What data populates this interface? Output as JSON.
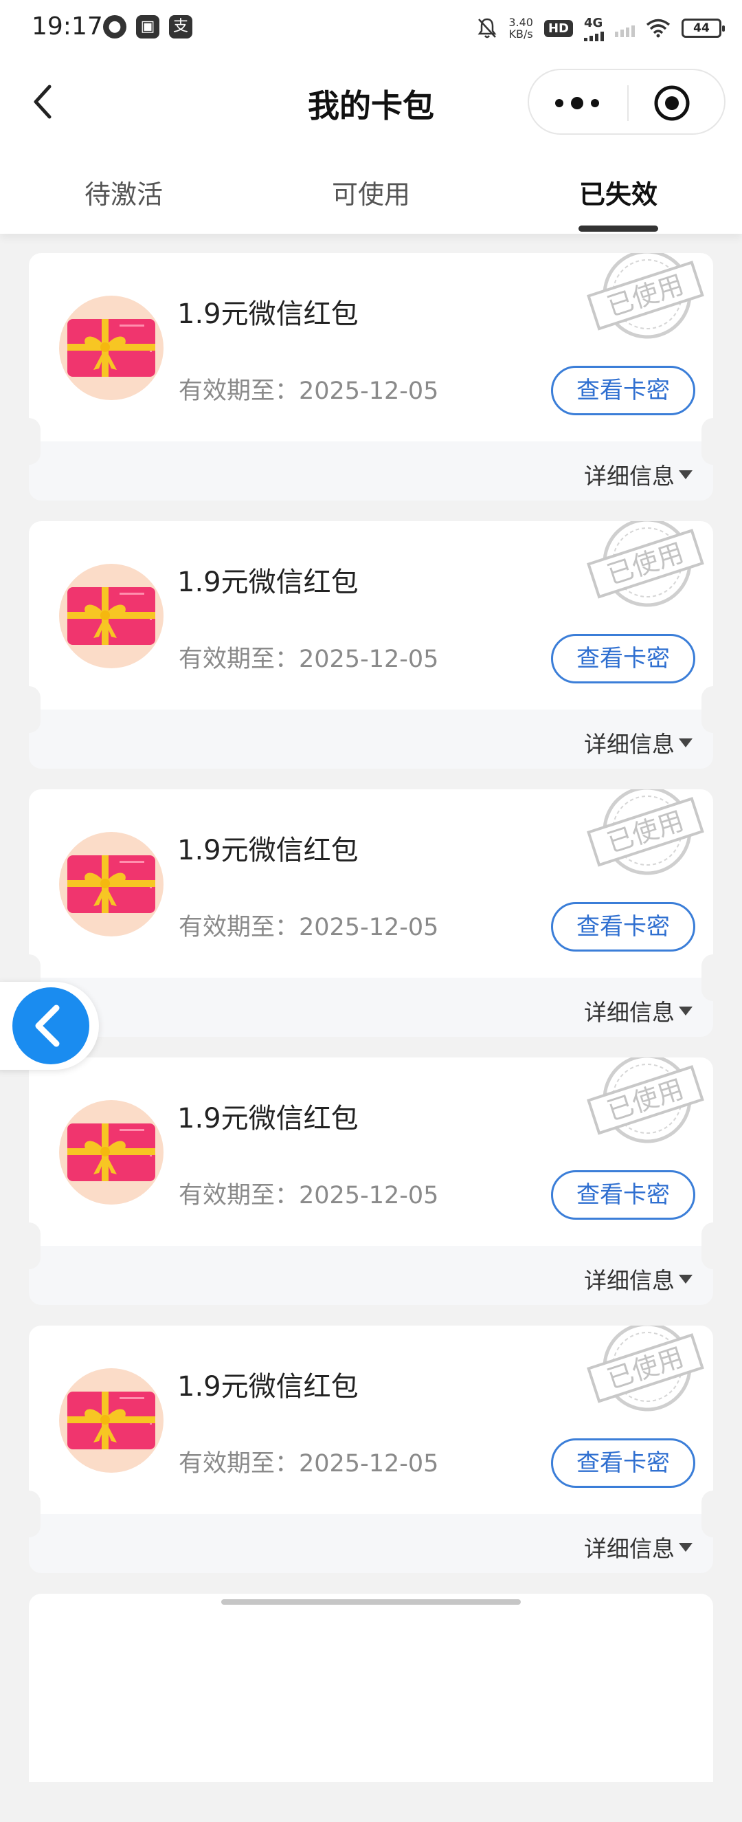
{
  "status_bar": {
    "time": "19:17",
    "net_speed_value": "3.40",
    "net_speed_unit": "KB/s",
    "hd_badge": "HD",
    "network": "4G",
    "battery": "44",
    "icons": [
      "chat-bubble-icon",
      "app-icon",
      "alipay-icon",
      "mute-bell-icon",
      "signal-icon",
      "wifi-icon",
      "battery-icon"
    ]
  },
  "header": {
    "title": "我的卡包",
    "icons": [
      "back-arrow-icon",
      "more-dots-icon",
      "close-target-icon"
    ]
  },
  "tabs": [
    {
      "label": "待激活",
      "active": false
    },
    {
      "label": "可使用",
      "active": false
    },
    {
      "label": "已失效",
      "active": true
    }
  ],
  "cards": [
    {
      "title": "1.9元微信红包",
      "expiry": "有效期至：2025-12-05",
      "button": "查看卡密",
      "stamp": "已使用",
      "detail": "详细信息"
    },
    {
      "title": "1.9元微信红包",
      "expiry": "有效期至：2025-12-05",
      "button": "查看卡密",
      "stamp": "已使用",
      "detail": "详细信息"
    },
    {
      "title": "1.9元微信红包",
      "expiry": "有效期至：2025-12-05",
      "button": "查看卡密",
      "stamp": "已使用",
      "detail": "详细信息"
    },
    {
      "title": "1.9元微信红包",
      "expiry": "有效期至：2025-12-05",
      "button": "查看卡密",
      "stamp": "已使用",
      "detail": "详细信息"
    },
    {
      "title": "1.9元微信红包",
      "expiry": "有效期至：2025-12-05",
      "button": "查看卡密",
      "stamp": "已使用",
      "detail": "详细信息"
    }
  ],
  "colors": {
    "accent_blue": "#2f6fd0",
    "float_button_blue": "#1a8cf0",
    "gift_pink": "#f0356e",
    "gift_ribbon": "#f7c623",
    "gift_bg": "#fbdcc8"
  }
}
